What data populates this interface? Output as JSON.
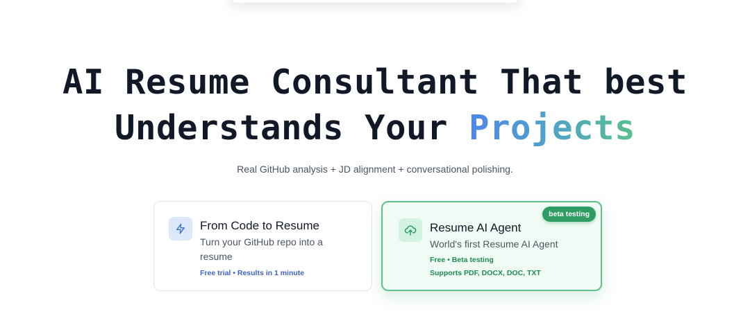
{
  "hero": {
    "title_line1": "AI Resume Consultant That best",
    "title_line2_prefix": "Understands Your ",
    "title_highlight": "Projects",
    "subtitle": "Real GitHub analysis + JD alignment + conversational polishing."
  },
  "cards": {
    "code_to_resume": {
      "icon": "lightning-icon",
      "title": "From Code to Resume",
      "description": "Turn your GitHub repo into a resume",
      "meta": "Free trial • Results in 1 minute"
    },
    "resume_agent": {
      "icon": "upload-cloud-icon",
      "badge": "beta testing",
      "title": "Resume AI Agent",
      "description": "World's first Resume AI Agent",
      "meta_line1": "Free • Beta testing",
      "meta_line2": "Supports PDF, DOCX, DOC, TXT"
    }
  },
  "colors": {
    "title_text": "#111827",
    "highlight_gradient_start": "#4f86e8",
    "highlight_gradient_end": "#5bbf8e",
    "card_code_accent": "#3b63c9",
    "card_agent_border": "#5fc08a",
    "badge_bg": "#2f9d63"
  }
}
